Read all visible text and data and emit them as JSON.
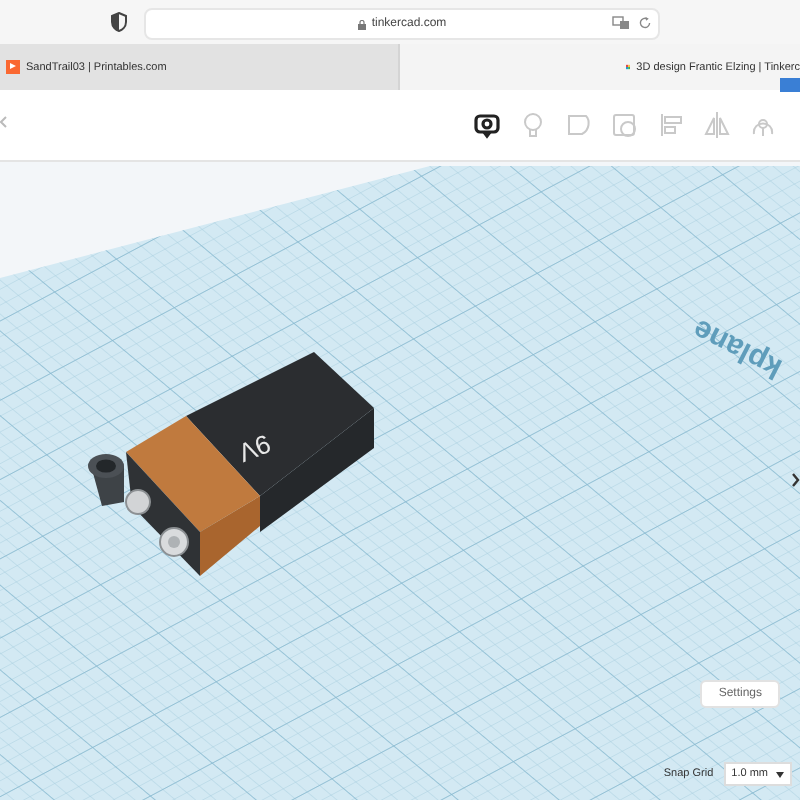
{
  "browser": {
    "address": "tinkercad.com",
    "tabs": [
      {
        "title": "SandTrail03 | Printables.com",
        "selected": false,
        "kind": "printables"
      },
      {
        "title": "3D design Frantic Elzing | Tinkerc",
        "selected": true,
        "kind": "tinkercad"
      }
    ]
  },
  "toolbar": {
    "tools": [
      {
        "kind": "note",
        "disabled": false
      },
      {
        "kind": "bulb",
        "disabled": true
      },
      {
        "kind": "shape",
        "disabled": true
      },
      {
        "kind": "hole",
        "disabled": true
      },
      {
        "kind": "align",
        "disabled": true
      },
      {
        "kind": "mirror",
        "disabled": true
      },
      {
        "kind": "cruise",
        "disabled": true
      }
    ]
  },
  "viewport": {
    "workplane_label": "kplane",
    "model_label": "9V",
    "settings_button": "Settings",
    "snap_grid": {
      "label": "Snap Grid",
      "value": "1.0 mm"
    }
  }
}
